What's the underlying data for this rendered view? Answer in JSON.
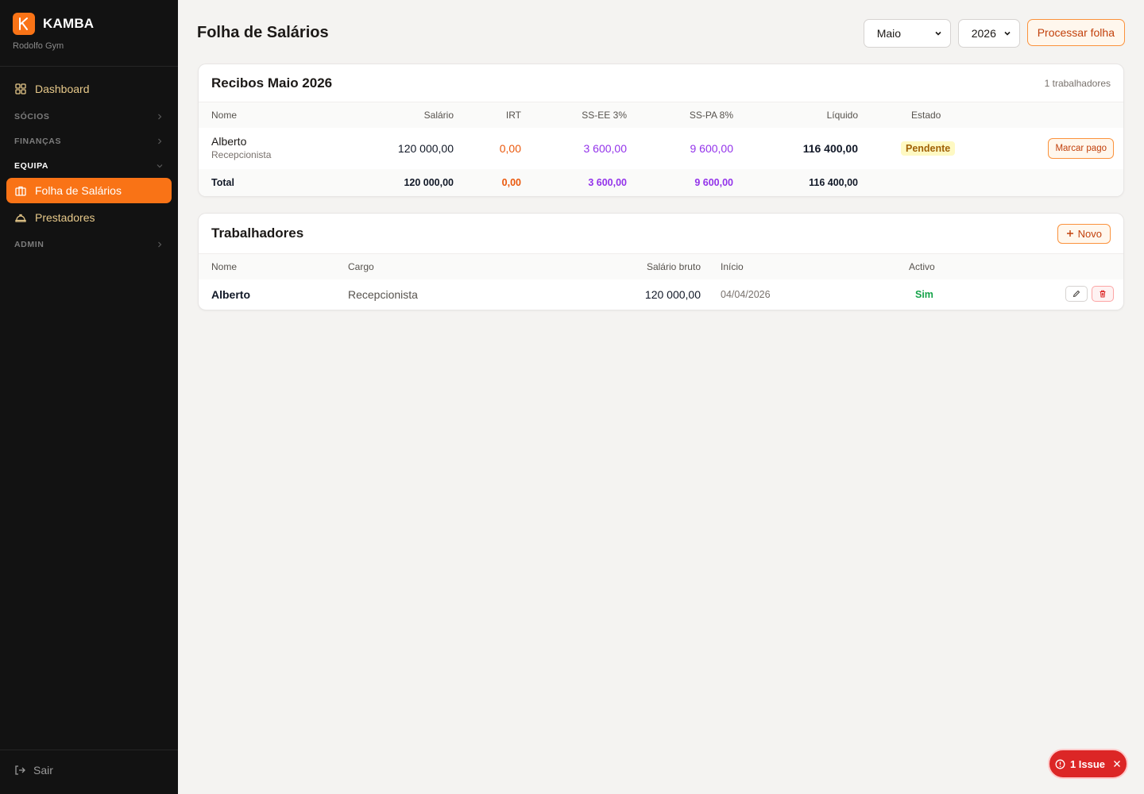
{
  "app": {
    "brand_name": "KAMBA",
    "brand_letter": "K",
    "org_name": "Rodolfo Gym"
  },
  "sidebar": {
    "dashboard": "Dashboard",
    "sections": [
      {
        "label": "SÓCIOS",
        "open": false
      },
      {
        "label": "FINANÇAS",
        "open": false
      },
      {
        "label": "EQUIPA",
        "open": true
      },
      {
        "label": "ADMIN",
        "open": false
      }
    ],
    "equipa_items": [
      {
        "label": "Folha de Salários",
        "active": true
      },
      {
        "label": "Prestadores",
        "active": false
      }
    ],
    "logout": "Sair"
  },
  "header": {
    "title": "Folha de Salários",
    "month": "Maio",
    "year": "2026",
    "process_button": "Processar folha"
  },
  "receipts": {
    "title": "Recibos Maio 2026",
    "count": "1 trabalhadores",
    "columns": [
      "Nome",
      "Salário",
      "IRT",
      "SS-EE 3%",
      "SS-PA 8%",
      "Líquido",
      "Estado"
    ],
    "rows": [
      {
        "name": "Alberto",
        "role": "Recepcionista",
        "salario": "120 000,00",
        "irt": "0,00",
        "ss_ee": "3 600,00",
        "ss_pa": "9 600,00",
        "liquido": "116 400,00",
        "estado": "Pendente",
        "action": "Marcar pago"
      }
    ],
    "total": {
      "label": "Total",
      "salario": "120 000,00",
      "irt": "0,00",
      "ss_ee": "3 600,00",
      "ss_pa": "9 600,00",
      "liquido": "116 400,00"
    }
  },
  "workers": {
    "title": "Trabalhadores",
    "new_button": "Novo",
    "columns": [
      "Nome",
      "Cargo",
      "Salário bruto",
      "Início",
      "Activo"
    ],
    "rows": [
      {
        "name": "Alberto",
        "cargo": "Recepcionista",
        "salario_bruto": "120 000,00",
        "inicio": "04/04/2026",
        "activo": "Sim"
      }
    ]
  },
  "issue_badge": "1 Issue",
  "colors": {
    "accent": "#f97316",
    "sidebar_bg": "#121212",
    "irt": "#ea580c",
    "ss": "#9333ea",
    "active_green": "#16a34a",
    "issue_red": "#dc2626"
  }
}
